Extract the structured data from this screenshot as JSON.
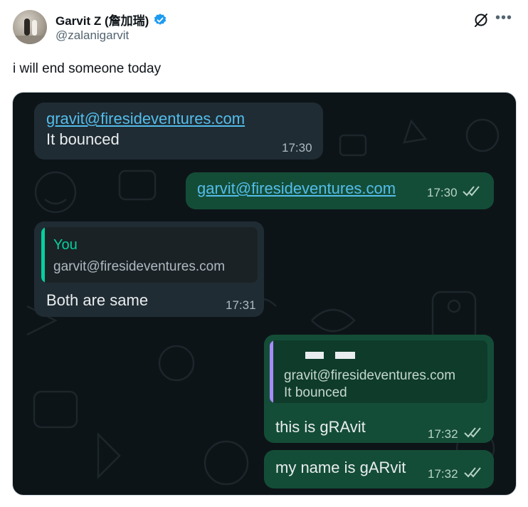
{
  "tweet": {
    "display_name": "Garvit Z (詹加瑞)",
    "handle": "@zalanigarvit",
    "text": "i will end someone today",
    "icons": {
      "verified": "verified-badge-icon",
      "grok": "grok-icon",
      "more": "more-icon"
    },
    "colors": {
      "verified": "#1d9bf0",
      "handle": "#536471"
    }
  },
  "chat": {
    "colors": {
      "background": "#0d1418",
      "incoming_bubble": "#202c33",
      "outgoing_bubble": "#144d37",
      "link": "#53bdeb",
      "read_ticks": "#b6d3c6"
    },
    "messages": [
      {
        "direction": "incoming",
        "link": "gravit@firesideventures.com",
        "text": "It bounced",
        "time": "17:30"
      },
      {
        "direction": "outgoing",
        "link": "garvit@firesideventures.com",
        "time": "17:30",
        "status": "read"
      },
      {
        "direction": "incoming",
        "quote": {
          "author": "You",
          "text": "garvit@firesideventures.com"
        },
        "text": "Both are same",
        "time": "17:31"
      },
      {
        "direction": "outgoing",
        "quote": {
          "text_line1": "gravit@firesideventures.com",
          "text_line2": "It bounced"
        },
        "text": "this is gRAvit",
        "time": "17:32",
        "status": "read"
      },
      {
        "direction": "outgoing",
        "text": "my name is gARvit",
        "time": "17:32",
        "status": "read"
      }
    ]
  }
}
